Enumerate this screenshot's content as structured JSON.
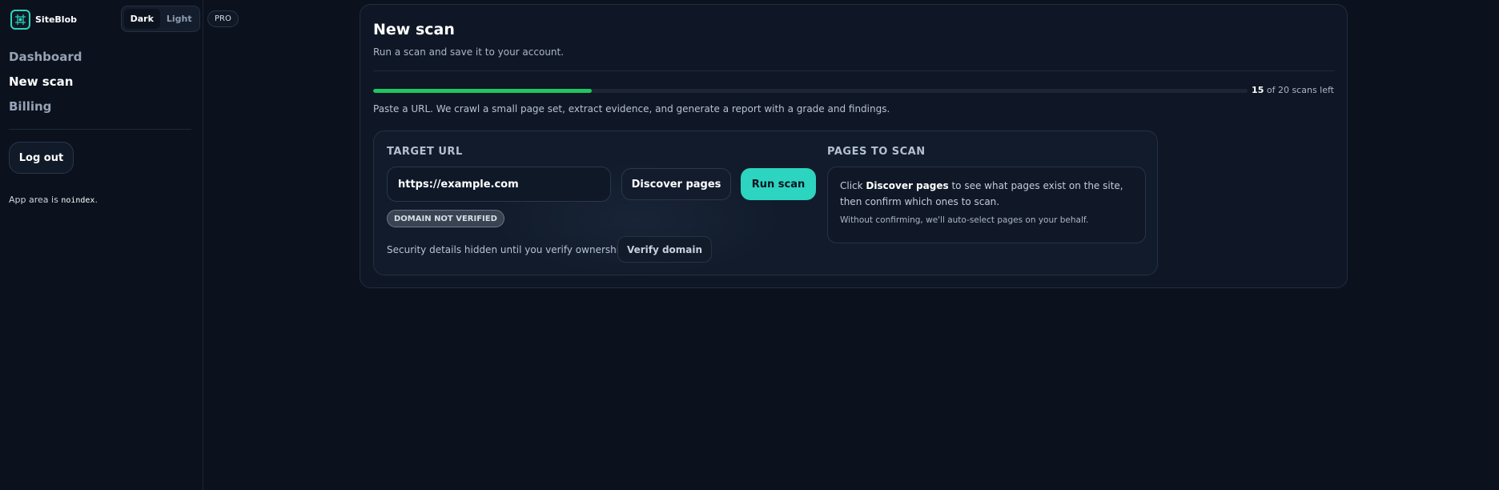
{
  "app": {
    "name": "SiteBlob",
    "logo_icon": "grid-icon",
    "accent": "#2dd4bf"
  },
  "theme": {
    "dark_label": "Dark",
    "light_label": "Light",
    "selected": "Dark"
  },
  "plan_badge": "PRO",
  "nav": {
    "items": [
      {
        "label": "Dashboard"
      },
      {
        "label": "New scan",
        "current": true
      },
      {
        "label": "Billing"
      }
    ],
    "logout_label": "Log out",
    "note_prefix": "App area is",
    "note_code": "noindex",
    "note_suffix": "."
  },
  "scan": {
    "title": "New scan",
    "subtitle": "Run a scan and save it to your account.",
    "usage": {
      "remaining": 15,
      "total": 20,
      "count_text": "15",
      "suffix": "of 20 scans left",
      "fill_fraction": 0.25,
      "bar_color": "#22c55e"
    },
    "intro": "Paste a URL. We crawl a small page set, extract evidence, and generate a report with a grade and findings.",
    "target": {
      "label": "TARGET URL",
      "value": "https://example.com",
      "discover_label": "Discover pages",
      "run_label": "Run scan",
      "domain_status": "DOMAIN NOT VERIFIED",
      "security_text": "Security details hidden until you verify ownership.",
      "verify_label": "Verify domain"
    },
    "pages": {
      "label": "PAGES TO SCAN",
      "hint_before": "Click",
      "hint_bold": "Discover pages",
      "hint_after": "to see what pages exist on the site, then confirm which ones to scan.",
      "note": "Without confirming, we'll auto-select pages on your behalf."
    }
  }
}
